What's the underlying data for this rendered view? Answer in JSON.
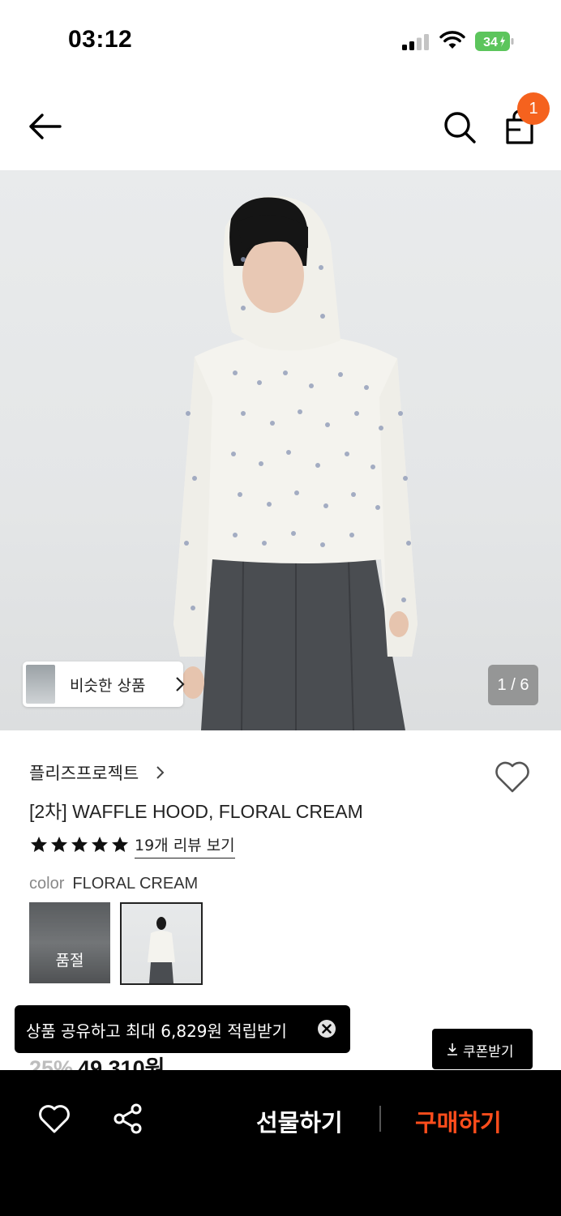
{
  "status_bar": {
    "time": "03:12",
    "battery": "34"
  },
  "header": {
    "cart_count": "1"
  },
  "gallery": {
    "similar_label": "비슷한 상품",
    "page_indicator": "1 / 6"
  },
  "product": {
    "brand": "플리즈프로젝트",
    "title": "[2차] WAFFLE HOOD, FLORAL CREAM",
    "rating_stars": 5,
    "review_link": "19개 리뷰 보기",
    "color_key": "color",
    "color_value": "FLORAL CREAM",
    "swatches": [
      {
        "status": "품절"
      },
      {
        "status": ""
      }
    ],
    "discount": "25%",
    "price": "49,310원"
  },
  "toast": {
    "text": "상품 공유하고 최대 6,829원 적립받기"
  },
  "coupon": {
    "label": "쿠폰받기"
  },
  "bottom_bar": {
    "gift_label": "선물하기",
    "buy_label": "구매하기"
  },
  "colors": {
    "accent": "#f5621e",
    "buy": "#ff4d1c"
  }
}
